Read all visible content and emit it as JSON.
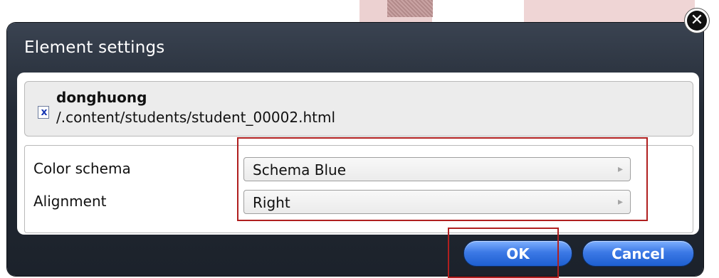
{
  "dialog": {
    "title": "Element settings",
    "close_icon": "close-icon"
  },
  "file": {
    "icon": "x-file-icon",
    "name": "donghuong",
    "path": "/.content/students/student_00002.html"
  },
  "settings": {
    "color_schema_label": "Color schema",
    "color_schema_value": "Schema Blue",
    "alignment_label": "Alignment",
    "alignment_value": "Right"
  },
  "buttons": {
    "ok": "OK",
    "cancel": "Cancel"
  },
  "colors": {
    "dialog_dark": "#1c222b",
    "button_blue": "#3c79e6",
    "highlight_red": "#b01f1f"
  }
}
